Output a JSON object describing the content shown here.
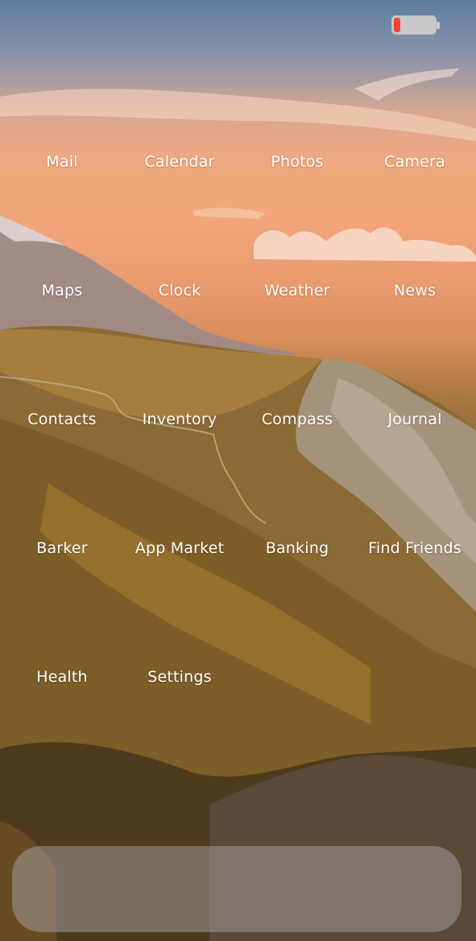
{
  "status_bar": {
    "battery_level": 0.15,
    "battery_color": "#f44336"
  },
  "home_screen": {
    "apps": [
      {
        "label": "Mail",
        "name": "app-mail"
      },
      {
        "label": "Calendar",
        "name": "app-calendar"
      },
      {
        "label": "Photos",
        "name": "app-photos"
      },
      {
        "label": "Camera",
        "name": "app-camera"
      },
      {
        "label": "Maps",
        "name": "app-maps"
      },
      {
        "label": "Clock",
        "name": "app-clock"
      },
      {
        "label": "Weather",
        "name": "app-weather"
      },
      {
        "label": "News",
        "name": "app-news"
      },
      {
        "label": "Contacts",
        "name": "app-contacts"
      },
      {
        "label": "Inventory",
        "name": "app-inventory"
      },
      {
        "label": "Compass",
        "name": "app-compass"
      },
      {
        "label": "Journal",
        "name": "app-journal"
      },
      {
        "label": "Barker",
        "name": "app-barker"
      },
      {
        "label": "App Market",
        "name": "app-app-market"
      },
      {
        "label": "Banking",
        "name": "app-banking"
      },
      {
        "label": "Find Friends",
        "name": "app-find-friends"
      },
      {
        "label": "Health",
        "name": "app-health"
      },
      {
        "label": "Settings",
        "name": "app-settings"
      }
    ]
  },
  "dock": {
    "apps": []
  }
}
